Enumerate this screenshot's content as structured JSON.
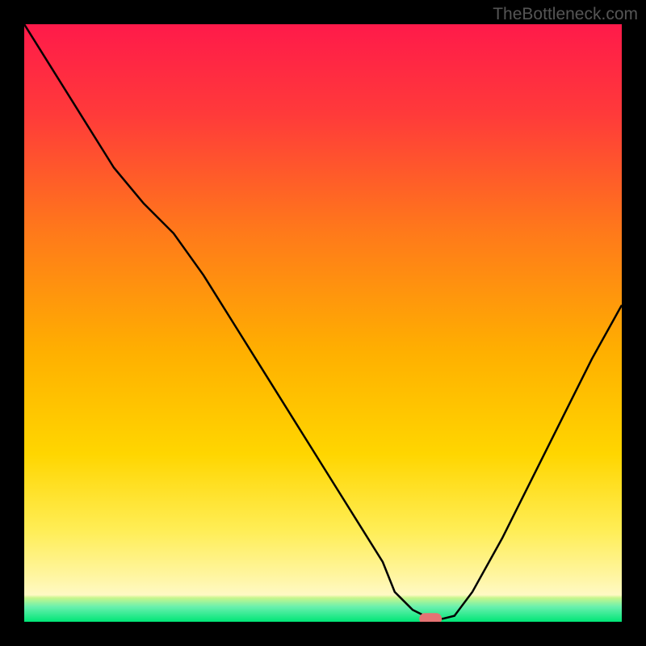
{
  "watermark": "TheBottleneck.com",
  "chart_data": {
    "type": "line",
    "title": "",
    "xlabel": "",
    "ylabel": "",
    "xlim": [
      0,
      100
    ],
    "ylim": [
      0,
      100
    ],
    "gradient_colors": {
      "top": "#ff1744",
      "upper_mid": "#ff6d00",
      "mid": "#ffd600",
      "lower_mid": "#ffee58",
      "bottom_band": "#fff59d",
      "green_band": "#00e676"
    },
    "curve": {
      "x": [
        0,
        5,
        10,
        15,
        20,
        25,
        30,
        35,
        40,
        45,
        50,
        55,
        60,
        62,
        65,
        68,
        70,
        72,
        75,
        80,
        85,
        90,
        95,
        100
      ],
      "y": [
        100,
        92,
        84,
        76,
        70,
        65,
        58,
        50,
        42,
        34,
        26,
        18,
        10,
        5,
        2,
        0.5,
        0.5,
        1,
        5,
        14,
        24,
        34,
        44,
        53
      ]
    },
    "marker": {
      "x": 68,
      "y": 0.5,
      "color": "#e57373"
    }
  }
}
